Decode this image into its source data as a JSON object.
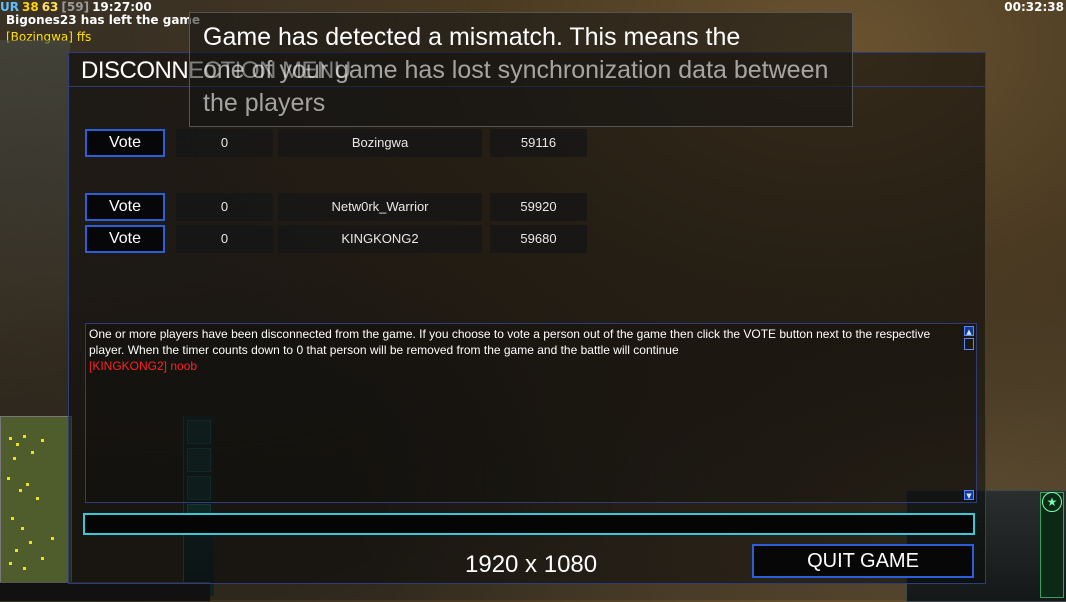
{
  "hud": {
    "ur_label": "UR",
    "stat_a": "38",
    "stat_b": "63",
    "stat_c": "[59]",
    "clock": "19:27:00",
    "game_timer": "00:32:38"
  },
  "chat": [
    "Bigones23 has left the game",
    "[Bozingwa] ffs"
  ],
  "notification": {
    "line1": "Game has detected a mismatch. This means the",
    "line2": "one of your game has lost synchronization data between",
    "line3": "the players"
  },
  "dialog": {
    "title": "DISCONNECTION MENU",
    "players": [
      {
        "vote_label": "Vote",
        "votes": "0",
        "name": "Bozingwa",
        "ping": "59116"
      },
      {
        "vote_label": "Vote",
        "votes": "0",
        "name": "Netw0rk_Warrior",
        "ping": "59920"
      },
      {
        "vote_label": "Vote",
        "votes": "0",
        "name": "KINGKONG2",
        "ping": "59680"
      }
    ],
    "message": "One or more players have been disconnected from the game. If you choose to vote a person out of the game then click the VOTE button next to the respective player. When the timer counts down to 0 that person will be removed from the game and the battle will continue",
    "chat_message": "[KINGKONG2] noob",
    "chat_input_value": "",
    "resolution_text": "1920 x 1080",
    "quit_label": "QUIT GAME"
  },
  "colors": {
    "accent_blue": "#2b5fd8",
    "input_cyan": "#38c8d8",
    "chat_red": "#ff2020",
    "chat_yellow": "#ffe000"
  }
}
